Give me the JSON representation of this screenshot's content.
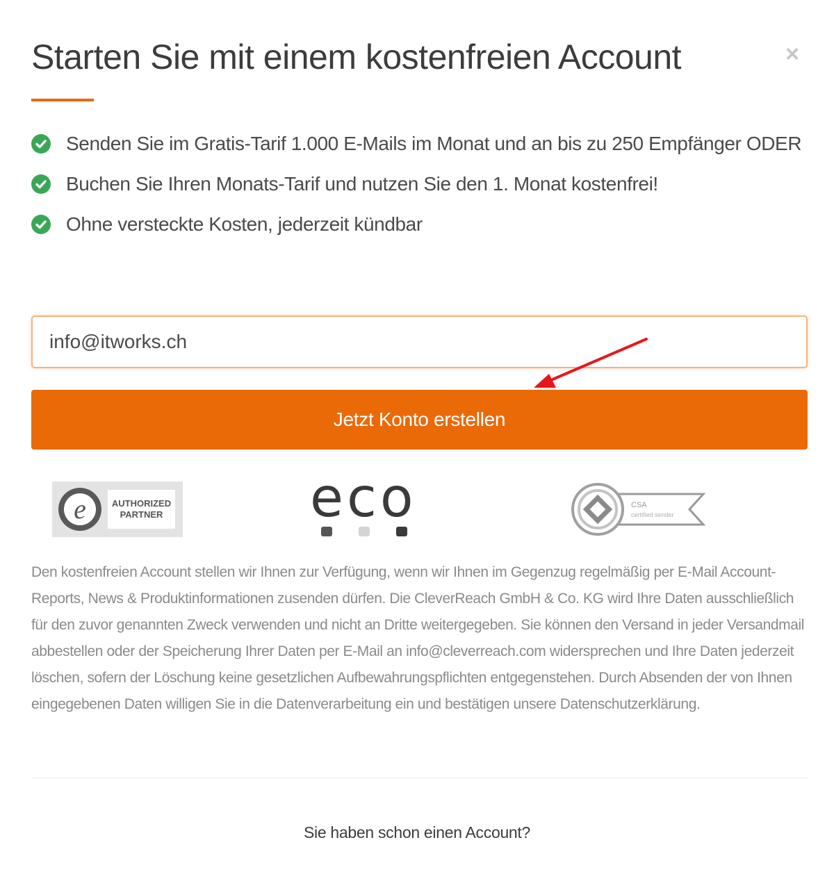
{
  "modal": {
    "title": "Starten Sie mit einem kostenfreien Account",
    "close_symbol": "×"
  },
  "benefits": [
    {
      "icon": "check-circle-icon",
      "text": "Senden Sie im Gratis-Tarif 1.000 E-Mails im Monat und an bis zu 250 Empfänger ODER"
    },
    {
      "icon": "check-circle-icon",
      "text": "Buchen Sie Ihren Monats-Tarif und nutzen Sie den 1. Monat kostenfrei!"
    },
    {
      "icon": "check-circle-icon",
      "text": "Ohne versteckte Kosten, jederzeit kündbar"
    }
  ],
  "form": {
    "email_value": "info@itworks.ch",
    "submit_label": "Jetzt Konto erstellen"
  },
  "logos": {
    "trusted_shops": {
      "line1": "AUTHORIZED",
      "line2": "PARTNER",
      "letter": "e"
    },
    "eco": {
      "text": "eco"
    },
    "csa": {
      "line1": "CSA",
      "line2": "certified sender"
    }
  },
  "disclaimer": "Den kostenfreien Account stellen wir Ihnen zur Verfügung, wenn wir Ihnen im Gegenzug regelmäßig per E-Mail Account-Reports, News & Produktinformationen zusenden dürfen. Die CleverReach GmbH & Co. KG wird Ihre Daten ausschließlich für den zuvor genannten Zweck verwenden und nicht an Dritte weitergegeben. Sie können den Versand in jeder Versandmail abbestellen oder der Speicherung Ihrer Daten per E-Mail an info@cleverreach.com widersprechen und Ihre Daten jederzeit löschen, sofern der Löschung keine gesetzlichen Aufbewahrungspflichten entgegenstehen. Durch Absenden der von Ihnen eingegebenen Daten willigen Sie in die Datenverarbeitung ein und bestätigen unsere Datenschutzerklärung.",
  "footer": {
    "login_prompt": "Sie haben schon einen Account?"
  },
  "colors": {
    "accent": "#eb6a08",
    "check": "#3aa757",
    "annotation_arrow": "#e8161b"
  }
}
